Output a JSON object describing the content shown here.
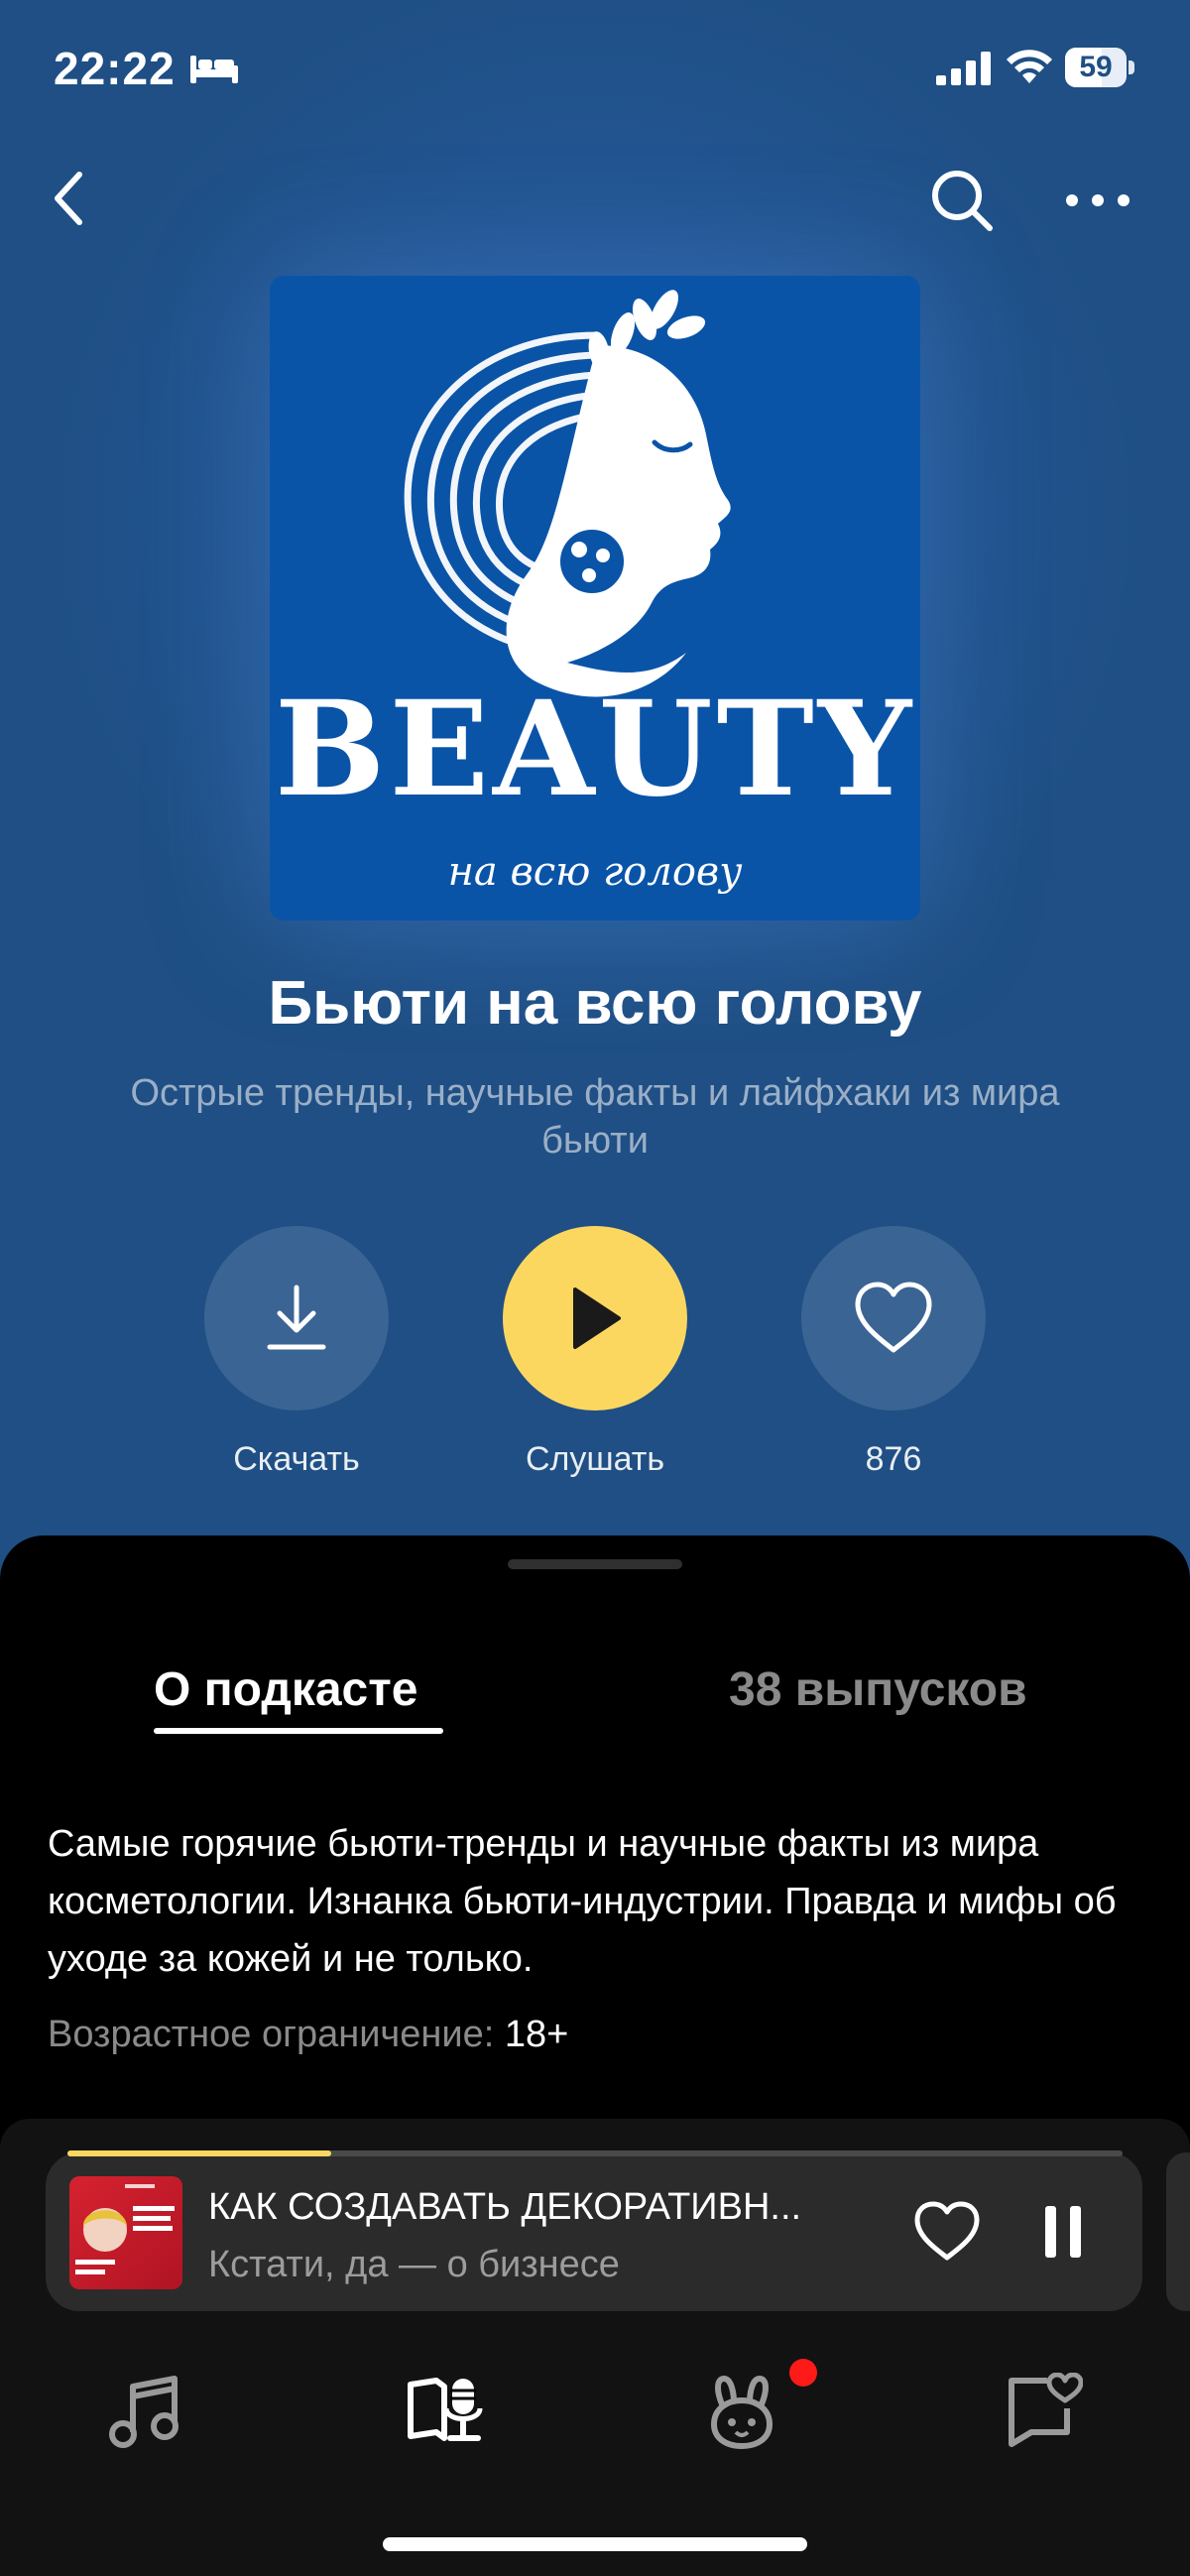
{
  "status_bar": {
    "time": "22:22",
    "battery": "59",
    "icons": [
      "bed-icon",
      "signal-icon",
      "wifi-icon",
      "battery-icon"
    ]
  },
  "nav": {
    "icons": [
      "back-icon",
      "search-icon",
      "more-icon"
    ]
  },
  "cover": {
    "title": "BEAUTY",
    "subtitle": "на всю голову"
  },
  "podcast": {
    "title": "Бьюти на всю голову",
    "description": "Острые тренды, научные факты и лайфхаки из мира бьюти"
  },
  "actions": {
    "download_label": "Скачать",
    "play_label": "Слушать",
    "likes_count": "876"
  },
  "tabs": {
    "about": "О подкасте",
    "episodes": "38 выпусков",
    "active": "about"
  },
  "about": {
    "text": "Самые горячие бьюти-тренды и научные факты из мира косметологии. Изнанка бьюти-индустрии. Правда и мифы об уходе за кожей и не только.",
    "age_label": "Возрастное ограничение:",
    "age_value": "18+"
  },
  "mini_player": {
    "episode_title": "КАК СОЗДАВАТЬ ДЕКОРАТИВН...",
    "show_name": "Кстати, да — о бизнесе",
    "progress": 0.25
  },
  "bottom_nav": {
    "items": [
      "music-icon",
      "podcasts-icon",
      "kids-icon",
      "collection-icon"
    ],
    "active": "podcasts-icon"
  },
  "colors": {
    "accent": "#fcd760",
    "header_bg": "#1f4f84",
    "cover_bg": "#0a54a8",
    "badge": "#ff1a1a"
  }
}
